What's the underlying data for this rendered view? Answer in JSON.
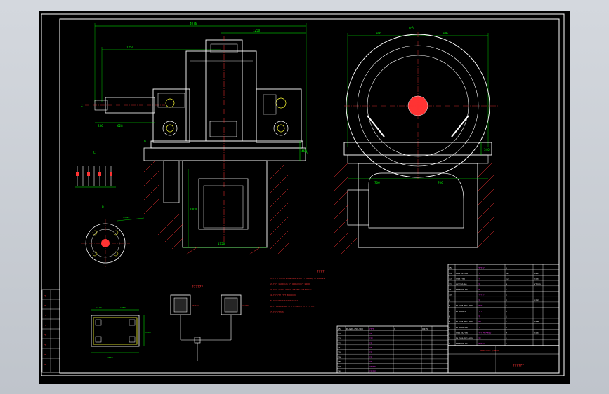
{
  "colors": {
    "background": "#000000",
    "frame": "#ffffff",
    "dimension": "#00ff00",
    "outline": "#ffffff",
    "hatch": "#ff3333",
    "centerline": "#ff3333",
    "table_text": "#ff33ff",
    "accent_cyan": "#33ffff",
    "yellow": "#ffff33"
  },
  "dimensions": {
    "top_overall": "4076",
    "top_right": "1250",
    "left_shaft": "1250",
    "left_a": "256",
    "left_b": "628",
    "right_a": "946",
    "right_b": "946",
    "right_top": "A-A",
    "pit_width": "1750",
    "pit_depth": "1800",
    "side_h": "460",
    "right_h": "540",
    "right_d1": "706",
    "right_d2": "706",
    "small_bolt": "4-M24",
    "plan_w": "2860",
    "plan_left": "1100",
    "plan_right": "1750",
    "plan_h": "1400"
  },
  "labels": {
    "section_a": "A",
    "section_b": "B",
    "section_c": "C",
    "view_aa": "A-A",
    "detail_i": "I"
  },
  "notes": {
    "title": "????",
    "lines": [
      "1. ???????? DFWbW06-8/1500   ?? 5000kg   ?? 6000kw",
      "2. ???? 1500mm   ?? 3000mm   ?? 1500",
      "3. ???? 1:4   ?? 380V   ?? 50Hz   ?? 4300kw",
      "4. ???????   ???? 3000mm",
      "5. ??????????????????????",
      "6. ?? 2000-4000 ??????-36 ???  ???????????",
      "7. ??????????"
    ]
  },
  "schematic": {
    "title": "??????",
    "left_label": "??????",
    "right_label": "??????"
  },
  "parts_right": {
    "rows": [
      [
        "15",
        "",
        "??????",
        "1",
        ""
      ],
      [
        "14",
        "GB5783-86",
        "??",
        "12",
        "Q235"
      ],
      [
        "13",
        "GB97-85",
        "??",
        "12",
        "Q235"
      ],
      [
        "12",
        "JB1705-86",
        "??",
        "4",
        "HT200"
      ],
      [
        "11",
        "DFW-01-10",
        "??",
        "1",
        ""
      ],
      [
        "10",
        "",
        "??????",
        "1",
        ""
      ],
      [
        "9",
        "",
        "??",
        "2",
        "Q235"
      ],
      [
        "8",
        "DLG08-281-300",
        "????",
        "1",
        ""
      ],
      [
        "7",
        "DFW-01-0",
        "????",
        "1",
        ""
      ],
      [
        "6",
        "",
        "??",
        "1",
        ""
      ],
      [
        "5",
        "DLG08-251-300",
        "???",
        "1",
        "Q235"
      ],
      [
        "4",
        "DFW-01-06",
        "??",
        "1",
        ""
      ],
      [
        "3",
        "GB5782-86",
        "???? M24x90",
        "4",
        "Q235"
      ],
      [
        "2",
        "DLG08-281-300",
        "???",
        "1",
        ""
      ],
      [
        "1",
        "DFW-01-0A",
        "??????",
        "1",
        ""
      ]
    ],
    "header": [
      "??",
      "??",
      "??",
      "??",
      "??"
    ],
    "drawing_no": "DFWbW06-8/1500"
  },
  "parts_left": {
    "rows": [
      [
        "25",
        "DLG08-251-300",
        "????",
        "1",
        "Q235"
      ],
      [
        "24",
        "",
        "??",
        "",
        ""
      ],
      [
        "23",
        "",
        "???",
        "",
        ""
      ],
      [
        "22",
        "",
        "??",
        "",
        ""
      ],
      [
        "21",
        "",
        "??",
        "",
        ""
      ],
      [
        "20",
        "",
        "??",
        "",
        ""
      ],
      [
        "19",
        "",
        "??",
        "",
        ""
      ],
      [
        "18",
        "",
        "??",
        "",
        ""
      ],
      [
        "17",
        "",
        "??????",
        "",
        ""
      ],
      [
        "16",
        "",
        "??????",
        "",
        ""
      ]
    ]
  },
  "title_block": {
    "title": "??????",
    "drawing_no": "DFWbW06-8/1500",
    "left_cells": [
      "??",
      "??",
      "??",
      "??",
      "??",
      "??",
      "??",
      "??"
    ]
  }
}
